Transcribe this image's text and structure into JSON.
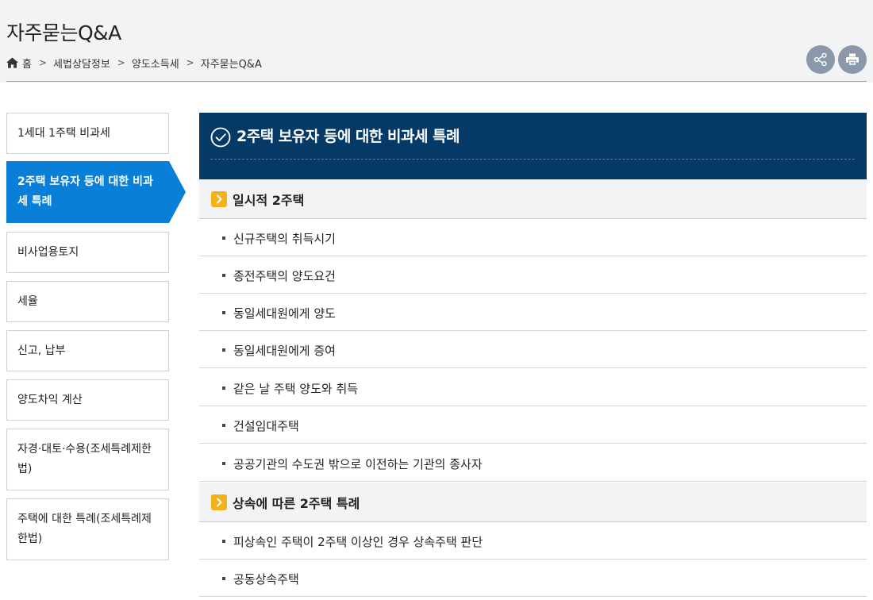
{
  "header": {
    "title": "자주묻는Q&A",
    "breadcrumb": [
      "홈",
      "세법상담정보",
      "양도소득세",
      "자주묻는Q&A"
    ],
    "separator": ">"
  },
  "sidebar": {
    "items": [
      {
        "label": "1세대 1주택 비과세"
      },
      {
        "label": "2주택 보유자 등에 대한 비과세 특례"
      },
      {
        "label": "비사업용토지"
      },
      {
        "label": "세율"
      },
      {
        "label": "신고, 납부"
      },
      {
        "label": "양도차익 계산"
      },
      {
        "label": "자경·대토·수용(조세특례제한법)"
      },
      {
        "label": "주택에 대한 특례(조세특례제한법)"
      }
    ]
  },
  "main": {
    "title": "2주택 보유자 등에 대한 비과세 특례",
    "sections": [
      {
        "label": "일시적 2주택",
        "items": [
          {
            "label": "신규주택의 취득시기"
          },
          {
            "label": "종전주택의 양도요건"
          },
          {
            "label": "동일세대원에게 양도"
          },
          {
            "label": "동일세대원에게 증여"
          },
          {
            "label": "같은 날 주택 양도와 취득"
          },
          {
            "label": "건설임대주택"
          },
          {
            "label": "공공기관의 수도권 밖으로 이전하는 기관의 종사자"
          }
        ]
      },
      {
        "label": "상속에 따른 2주택 특례",
        "items": [
          {
            "label": "피상속인 주택이 2주택 이상인 경우 상속주택 판단"
          },
          {
            "label": "공동상속주택"
          }
        ]
      }
    ]
  },
  "icons": {
    "home": "home-icon",
    "share": "share-icon",
    "print": "print-icon",
    "check": "check-circle-icon",
    "section": "chevron-right-icon"
  },
  "colors": {
    "active": "#0a7fd8",
    "header": "#063a66",
    "section_icon": "#f3b21a",
    "round_button": "#8b98a9"
  }
}
